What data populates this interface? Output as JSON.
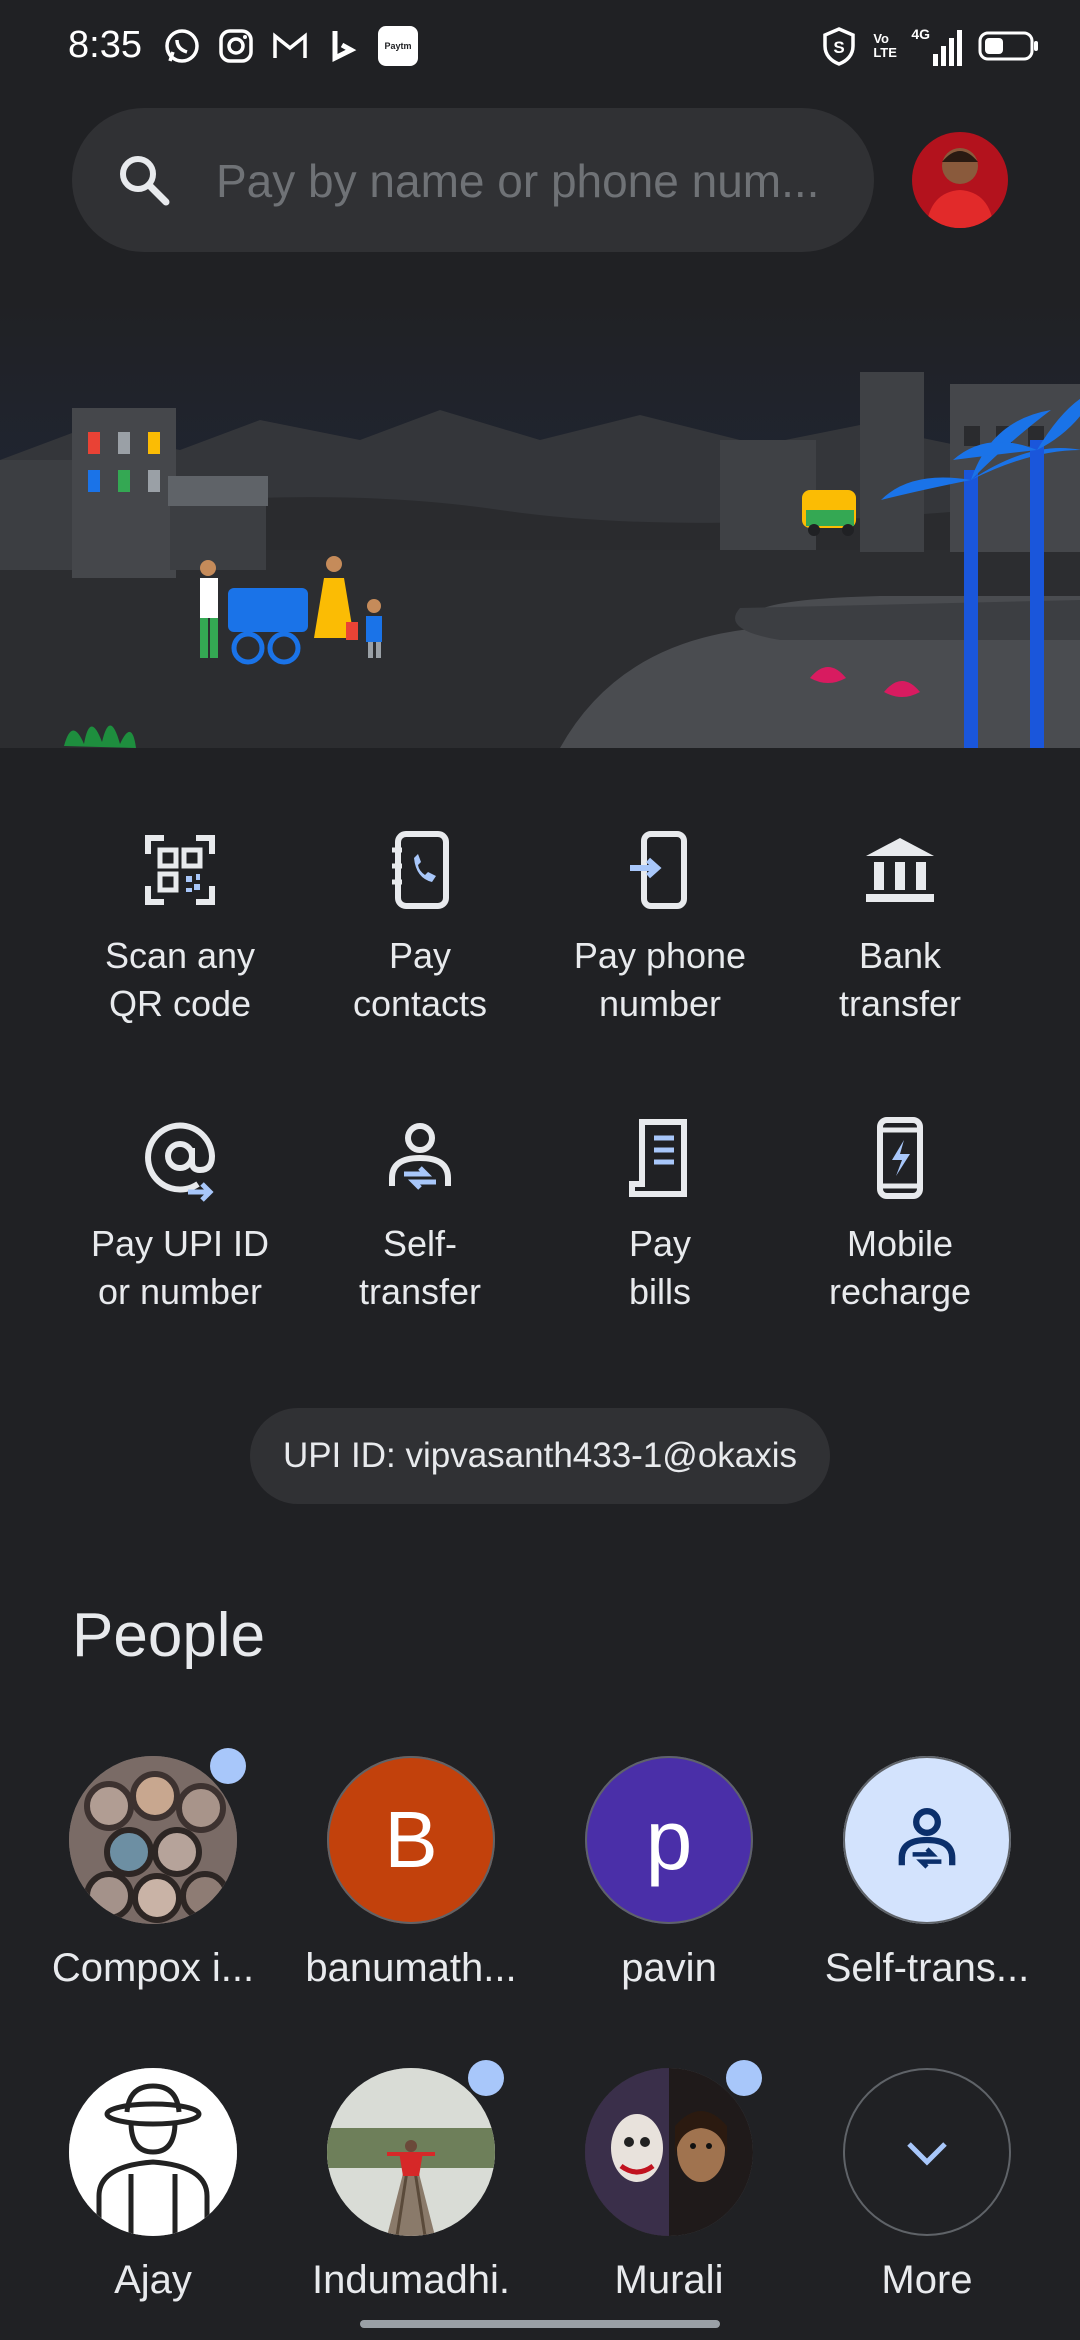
{
  "status_bar": {
    "time": "8:35",
    "notification_icons": [
      "whatsapp-icon",
      "instagram-icon",
      "gmail-icon",
      "bing-icon",
      "paytm-icon"
    ],
    "paytm_label": "Paytm",
    "right_icons": [
      "shield-icon",
      "volte-icon",
      "4g-signal-icon",
      "battery-icon"
    ],
    "volte_label": "Vo LTE",
    "network_label": "4G"
  },
  "search": {
    "placeholder": "Pay by name or phone num..."
  },
  "actions": [
    {
      "label": "Scan any\nQR code",
      "icon": "qr-scan-icon"
    },
    {
      "label": "Pay\ncontacts",
      "icon": "contacts-phone-icon"
    },
    {
      "label": "Pay phone\nnumber",
      "icon": "phone-transfer-icon"
    },
    {
      "label": "Bank\ntransfer",
      "icon": "bank-icon"
    },
    {
      "label": "Pay UPI ID\nor number",
      "icon": "at-sign-icon"
    },
    {
      "label": "Self-\ntransfer",
      "icon": "self-transfer-icon"
    },
    {
      "label": "Pay\nbills",
      "icon": "bill-icon"
    },
    {
      "label": "Mobile\nrecharge",
      "icon": "mobile-recharge-icon"
    }
  ],
  "upi_id": "UPI ID: vipvasanth433-1@okaxis",
  "people": {
    "title": "People",
    "items": [
      {
        "name": "Compox i...",
        "avatar": "photo",
        "dot": true
      },
      {
        "name": "banumath...",
        "avatar": "letter",
        "letter": "B",
        "color": "#c2410c",
        "dot": false
      },
      {
        "name": "pavin",
        "avatar": "letter",
        "letter": "p",
        "color": "#4a2fa8",
        "dot": false
      },
      {
        "name": "Self-trans...",
        "avatar": "self",
        "dot": false
      },
      {
        "name": "Ajay",
        "avatar": "photo",
        "dot": false
      },
      {
        "name": "Indumadhi.",
        "avatar": "photo",
        "dot": true
      },
      {
        "name": "Murali",
        "avatar": "photo",
        "dot": true
      },
      {
        "name": "More",
        "avatar": "more",
        "dot": false
      }
    ]
  },
  "colors": {
    "background": "#202124",
    "surface": "#303134",
    "accent": "#a8c7fa"
  }
}
